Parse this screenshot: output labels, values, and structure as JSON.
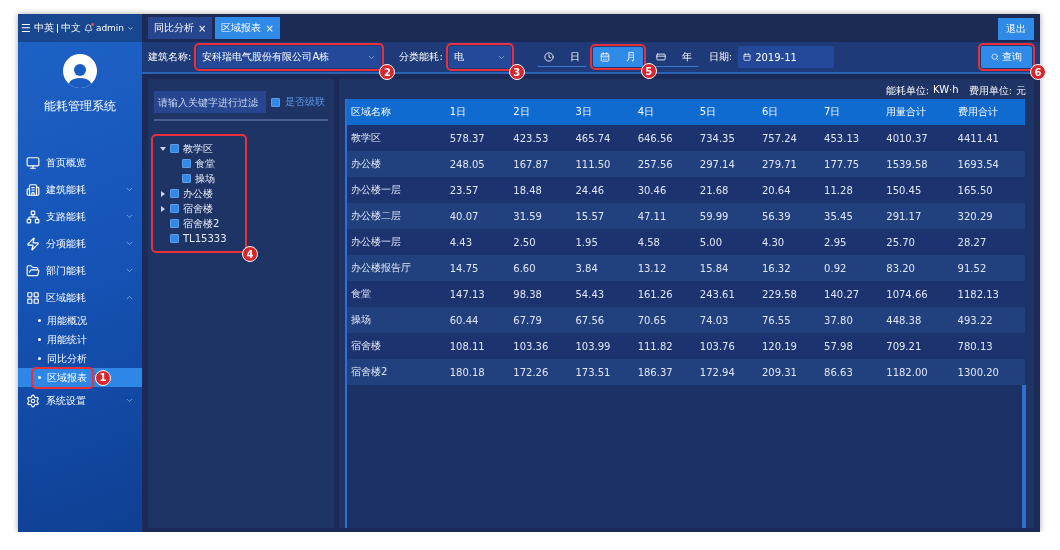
{
  "header": {
    "menu_icon": "☰",
    "language": [
      "中英",
      "中文"
    ],
    "user": "admin",
    "notification": true
  },
  "tabs": [
    {
      "label": "同比分析",
      "close": "×",
      "selected": false
    },
    {
      "label": "区域报表",
      "close": "×",
      "selected": true
    }
  ],
  "logout": "退出",
  "sidebar": {
    "title": "能耗管理系统",
    "items": [
      {
        "label": "首页概览",
        "kind": "link"
      },
      {
        "label": "建筑能耗",
        "kind": "group",
        "expanded": false
      },
      {
        "label": "支路能耗",
        "kind": "group",
        "expanded": false
      },
      {
        "label": "分项能耗",
        "kind": "group",
        "expanded": false
      },
      {
        "label": "部门能耗",
        "kind": "group",
        "expanded": false
      },
      {
        "label": "区域能耗",
        "kind": "group",
        "expanded": true,
        "children": [
          {
            "label": "用能概况",
            "selected": false
          },
          {
            "label": "用能统计",
            "selected": false
          },
          {
            "label": "同比分析",
            "selected": false
          },
          {
            "label": "区域报表",
            "selected": true,
            "annotation": "1"
          }
        ]
      },
      {
        "label": "系统设置",
        "kind": "group",
        "expanded": false
      }
    ]
  },
  "filters": {
    "building_label": "建筑名称:",
    "building_value": "安科瑞电气股份有限公司A栋",
    "building_annotation": "2",
    "category_label": "分类能耗:",
    "category_value": "电",
    "category_annotation": "3",
    "periods": [
      {
        "label": "日",
        "selected": false
      },
      {
        "label": "月",
        "selected": true,
        "annotation": "5"
      },
      {
        "label": "年",
        "selected": false
      }
    ],
    "date_label": "日期:",
    "date_value": "2019-11",
    "query": "查询",
    "query_annotation": "6"
  },
  "tree_panel": {
    "search": {
      "placeholder": "请输入关键字进行过滤"
    },
    "cascade": {
      "label": "是否级联",
      "checked": true
    },
    "annotation": "4",
    "tree": [
      {
        "label": "教学区",
        "checked": true,
        "expanded": true,
        "children": [
          {
            "label": "食堂",
            "checked": true
          },
          {
            "label": "操场",
            "checked": true
          }
        ]
      },
      {
        "label": "办公楼",
        "checked": true,
        "expanded": false
      },
      {
        "label": "宿舍楼",
        "checked": true,
        "expanded": false
      },
      {
        "label": "宿舍楼2",
        "checked": true
      },
      {
        "label": "TL15333",
        "checked": true
      }
    ]
  },
  "units": [
    {
      "label": "能耗单位:",
      "value": "KW·h"
    },
    {
      "label": "费用单位:",
      "value": "元"
    }
  ],
  "table": {
    "columns": [
      "区域名称",
      "1日",
      "2日",
      "3日",
      "4日",
      "5日",
      "6日",
      "7日",
      "用量合计",
      "费用合计"
    ],
    "rows": [
      [
        "教学区",
        "578.37",
        "423.53",
        "465.74",
        "646.56",
        "734.35",
        "757.24",
        "453.13",
        "4010.37",
        "4411.41"
      ],
      [
        "办公楼",
        "248.05",
        "167.87",
        "111.50",
        "257.56",
        "297.14",
        "279.71",
        "177.75",
        "1539.58",
        "1693.54"
      ],
      [
        "办公楼一层",
        "23.57",
        "18.48",
        "24.46",
        "30.46",
        "21.68",
        "20.64",
        "11.28",
        "150.45",
        "165.50"
      ],
      [
        "办公楼二层",
        "40.07",
        "31.59",
        "15.57",
        "47.11",
        "59.99",
        "56.39",
        "35.45",
        "291.17",
        "320.29"
      ],
      [
        "办公楼一层",
        "4.43",
        "2.50",
        "1.95",
        "4.58",
        "5.00",
        "4.30",
        "2.95",
        "25.70",
        "28.27"
      ],
      [
        "办公楼报告厅",
        "14.75",
        "6.60",
        "3.84",
        "13.12",
        "15.84",
        "16.32",
        "0.92",
        "83.20",
        "91.52"
      ],
      [
        "食堂",
        "147.13",
        "98.38",
        "54.43",
        "161.26",
        "243.61",
        "229.58",
        "140.27",
        "1074.66",
        "1182.13"
      ],
      [
        "操场",
        "60.44",
        "67.79",
        "67.56",
        "70.65",
        "74.03",
        "76.55",
        "37.80",
        "448.38",
        "493.22"
      ],
      [
        "宿舍楼",
        "108.11",
        "103.36",
        "103.99",
        "111.82",
        "103.76",
        "120.19",
        "57.98",
        "709.21",
        "780.13"
      ],
      [
        "宿舍楼2",
        "180.18",
        "172.26",
        "173.51",
        "186.37",
        "172.94",
        "209.31",
        "86.63",
        "1182.00",
        "1300.20"
      ]
    ]
  }
}
